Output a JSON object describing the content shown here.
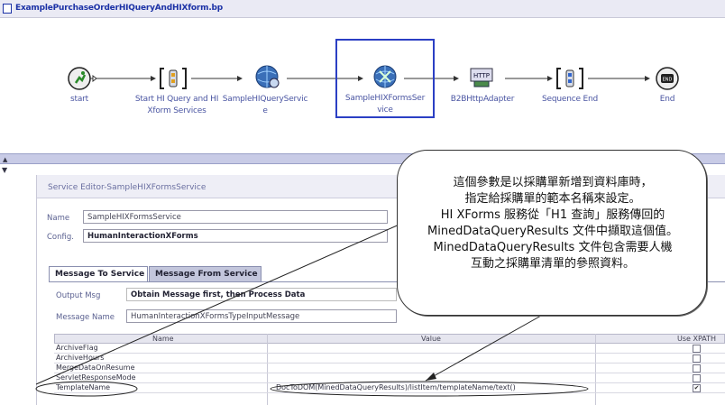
{
  "workflow": {
    "title": "ExamplePurchaseOrderHIQueryAndHIXform.bp",
    "nodes": [
      {
        "icon": "start-runner-icon",
        "label_lines": [
          "start"
        ]
      },
      {
        "icon": "sequence-start-icon",
        "label_lines": [
          "Start HI Query and HI",
          "Xform Services"
        ]
      },
      {
        "icon": "query-service-globe-icon",
        "label_lines": [
          "SampleHIQueryServic",
          "e"
        ]
      },
      {
        "icon": "xforms-service-globe-icon",
        "label_lines": [
          "SampleHIXFormsSer",
          "vice"
        ]
      },
      {
        "icon": "http-adapter-icon",
        "label_lines": [
          "B2BHttpAdapter"
        ]
      },
      {
        "icon": "sequence-end-icon",
        "label_lines": [
          "Sequence End"
        ]
      },
      {
        "icon": "end-stop-icon",
        "label_lines": [
          "End"
        ]
      }
    ]
  },
  "editor": {
    "title": "Service Editor-SampleHIXFormsService",
    "name_label": "Name",
    "name_value": "SampleHIXFormsService",
    "config_label": "Config.",
    "config_value": "HumanInteractionXForms",
    "tabs": [
      "Message To Service",
      "Message From Service"
    ],
    "output_msg_label": "Output Msg",
    "output_msg_value": "Obtain Message first, then Process Data",
    "message_name_label": "Message Name",
    "message_name_value": "HumanInteractionXFormsTypeInputMessage"
  },
  "table": {
    "headers": [
      "Name",
      "Value",
      "Use XPATH"
    ],
    "rows": [
      {
        "name": "ArchiveFlag",
        "value": "",
        "use_xpath": false
      },
      {
        "name": "ArchiveHours",
        "value": "",
        "use_xpath": false
      },
      {
        "name": "MergeDataOnResume",
        "value": "",
        "use_xpath": false
      },
      {
        "name": "ServletResponseMode",
        "value": "",
        "use_xpath": false
      },
      {
        "name": "TemplateName",
        "value": "DocToDOM(MinedDataQueryResults)/listItem/templateName/text()",
        "use_xpath": true
      }
    ]
  },
  "callout": {
    "lines": [
      "這個參數是以採購單新增到資料庫時，",
      "指定給採購單的範本名稱來設定。",
      "HI XForms 服務從「H1 查詢」服務傳回的",
      "MinedDataQueryResults 文件中擷取這個值。",
      "MinedDataQueryResults 文件包含需要人機",
      "互動之採購單清單的參照資料。"
    ]
  },
  "colors": {
    "accent": "#2b3fc4",
    "label_blue": "#4a55a2",
    "splitter": "#c8cbe6",
    "tab_inactive": "#c3c6dc"
  }
}
